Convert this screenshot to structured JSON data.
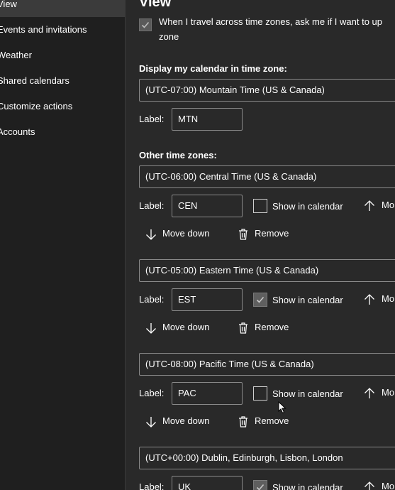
{
  "sidebar": {
    "items": [
      {
        "label": "View"
      },
      {
        "label": "Events and invitations"
      },
      {
        "label": "Weather"
      },
      {
        "label": "Shared calendars"
      },
      {
        "label": "Customize actions"
      },
      {
        "label": "Accounts"
      }
    ]
  },
  "main": {
    "title": "View",
    "travel_option": {
      "line1": "When I travel across time zones, ask me if I want to up",
      "line2": "zone",
      "checked": true
    },
    "display_tz": {
      "heading": "Display my calendar in time zone:",
      "value": "(UTC-07:00) Mountain Time (US & Canada)",
      "label_caption": "Label:",
      "label_value": "MTN"
    },
    "other_heading": "Other time zones:",
    "other_zones": [
      {
        "tz": "(UTC-06:00) Central Time (US & Canada)",
        "label_caption": "Label:",
        "label_value": "CEN",
        "show_label": "Show in calendar",
        "show_checked": false,
        "move_up": "Mo",
        "move_down": "Move down",
        "remove": "Remove"
      },
      {
        "tz": "(UTC-05:00) Eastern Time (US & Canada)",
        "label_caption": "Label:",
        "label_value": "EST",
        "show_label": "Show in calendar",
        "show_checked": true,
        "move_up": "Mo",
        "move_down": "Move down",
        "remove": "Remove"
      },
      {
        "tz": "(UTC-08:00) Pacific Time (US & Canada)",
        "label_caption": "Label:",
        "label_value": "PAC",
        "show_label": "Show in calendar",
        "show_checked": false,
        "move_up": "Mo",
        "move_down": "Move down",
        "remove": "Remove"
      },
      {
        "tz": "(UTC+00:00) Dublin, Edinburgh, Lisbon, London",
        "label_caption": "Label:",
        "label_value": "UK",
        "show_label": "Show in calendar",
        "show_checked": true,
        "move_up": "Mo"
      }
    ]
  },
  "colors": {
    "sidebar_bg": "#1f1f1f",
    "selected_bg": "#3b3b3b",
    "main_bg": "#292929",
    "border": "#8a8a8a",
    "text": "#ffffff"
  },
  "icons": [
    "checkmark-icon",
    "arrow-up-icon",
    "arrow-down-icon",
    "trash-icon",
    "mouse-cursor-icon"
  ]
}
